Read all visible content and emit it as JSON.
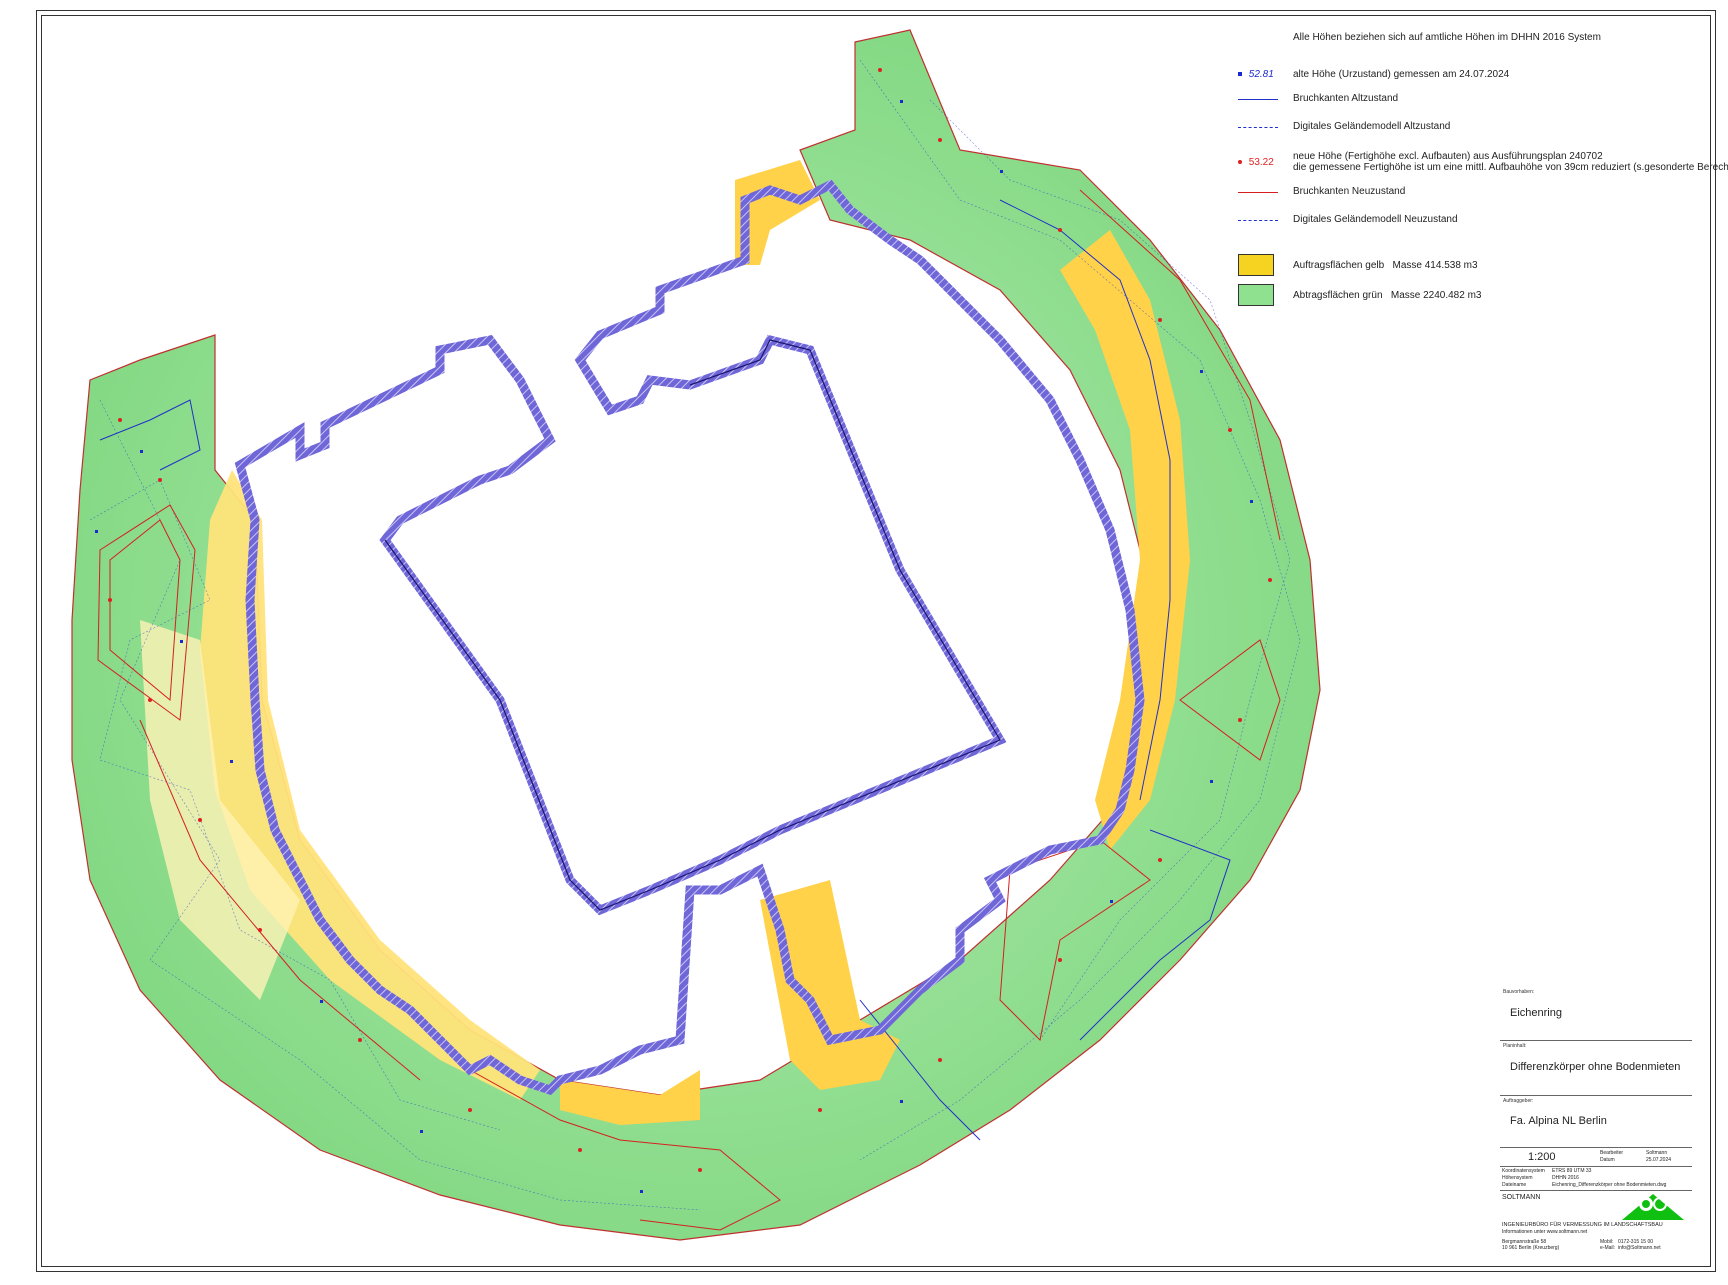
{
  "legend": {
    "header": "Alle Höhen beziehen sich auf amtliche Höhen im DHHN 2016 System",
    "old_height_sample": "52.81",
    "old_height_text": "alte Höhe (Urzustand) gemessen am 24.07.2024",
    "old_breaklines": "Bruchkanten Altzustand",
    "old_dtm": "Digitales Geländemodell Altzustand",
    "new_height_sample": "53.22",
    "new_height_text_1": "neue Höhe (Fertighöhe excl. Aufbauten) aus Ausführungsplan 240702",
    "new_height_text_2": "die gemessene Fertighöhe ist um eine mittl. Aufbauhöhe von 39cm reduziert (s.gesonderte Berechnung)",
    "new_breaklines": "Bruchkanten Neuzustand",
    "new_dtm": "Digitales Geländemodell Neuzustand",
    "fill_label": "Auftragsflächen gelb",
    "fill_mass": "Masse 414.538  m3",
    "cut_label": "Abtragsflächen grün",
    "cut_mass": "Masse  2240.482  m3"
  },
  "title_block": {
    "project_label": "Bauvorhaben:",
    "project": "Eichenring",
    "plan_label": "Planinhalt:",
    "plan": "Differenzkörper ohne Bodenmieten",
    "client_label": "Auftraggeber:",
    "client": "Fa. Alpina NL Berlin",
    "scale": "1:200",
    "editor_label": "Bearbeiter",
    "editor": "Soltmann",
    "date_label": "Datum",
    "date": "25.07.2024",
    "crs_label": "Koordinatensystem",
    "crs": "ETRS 89 UTM 33",
    "height_label": "Höhensystem",
    "height_system": "DHHN 2016",
    "file_label": "Dateiname",
    "file": "Eichenring_Differenzkörper ohne Bodenmieten.dwg",
    "company": "SOLTMANN",
    "office": "INGENIEURBÜRO FÜR VERMESSUNG IM LANDSCHAFTSBAU",
    "info": "Informationen unter www.soltmann.net",
    "street": "Bergmannstraße 58",
    "city": "10 961 Berlin (Kreuzberg)",
    "mobil_label": "Mobil:",
    "mobil": "0172-315 15 00",
    "mail_label": "e-Mail:",
    "mail": "info@Soltmann.net"
  },
  "colors": {
    "cut_green": "#8fe08f",
    "fill_yellow": "#ffd24a",
    "building_outline": "#5a50c8",
    "new_lines": "#d42020",
    "old_lines": "#2030c8"
  }
}
